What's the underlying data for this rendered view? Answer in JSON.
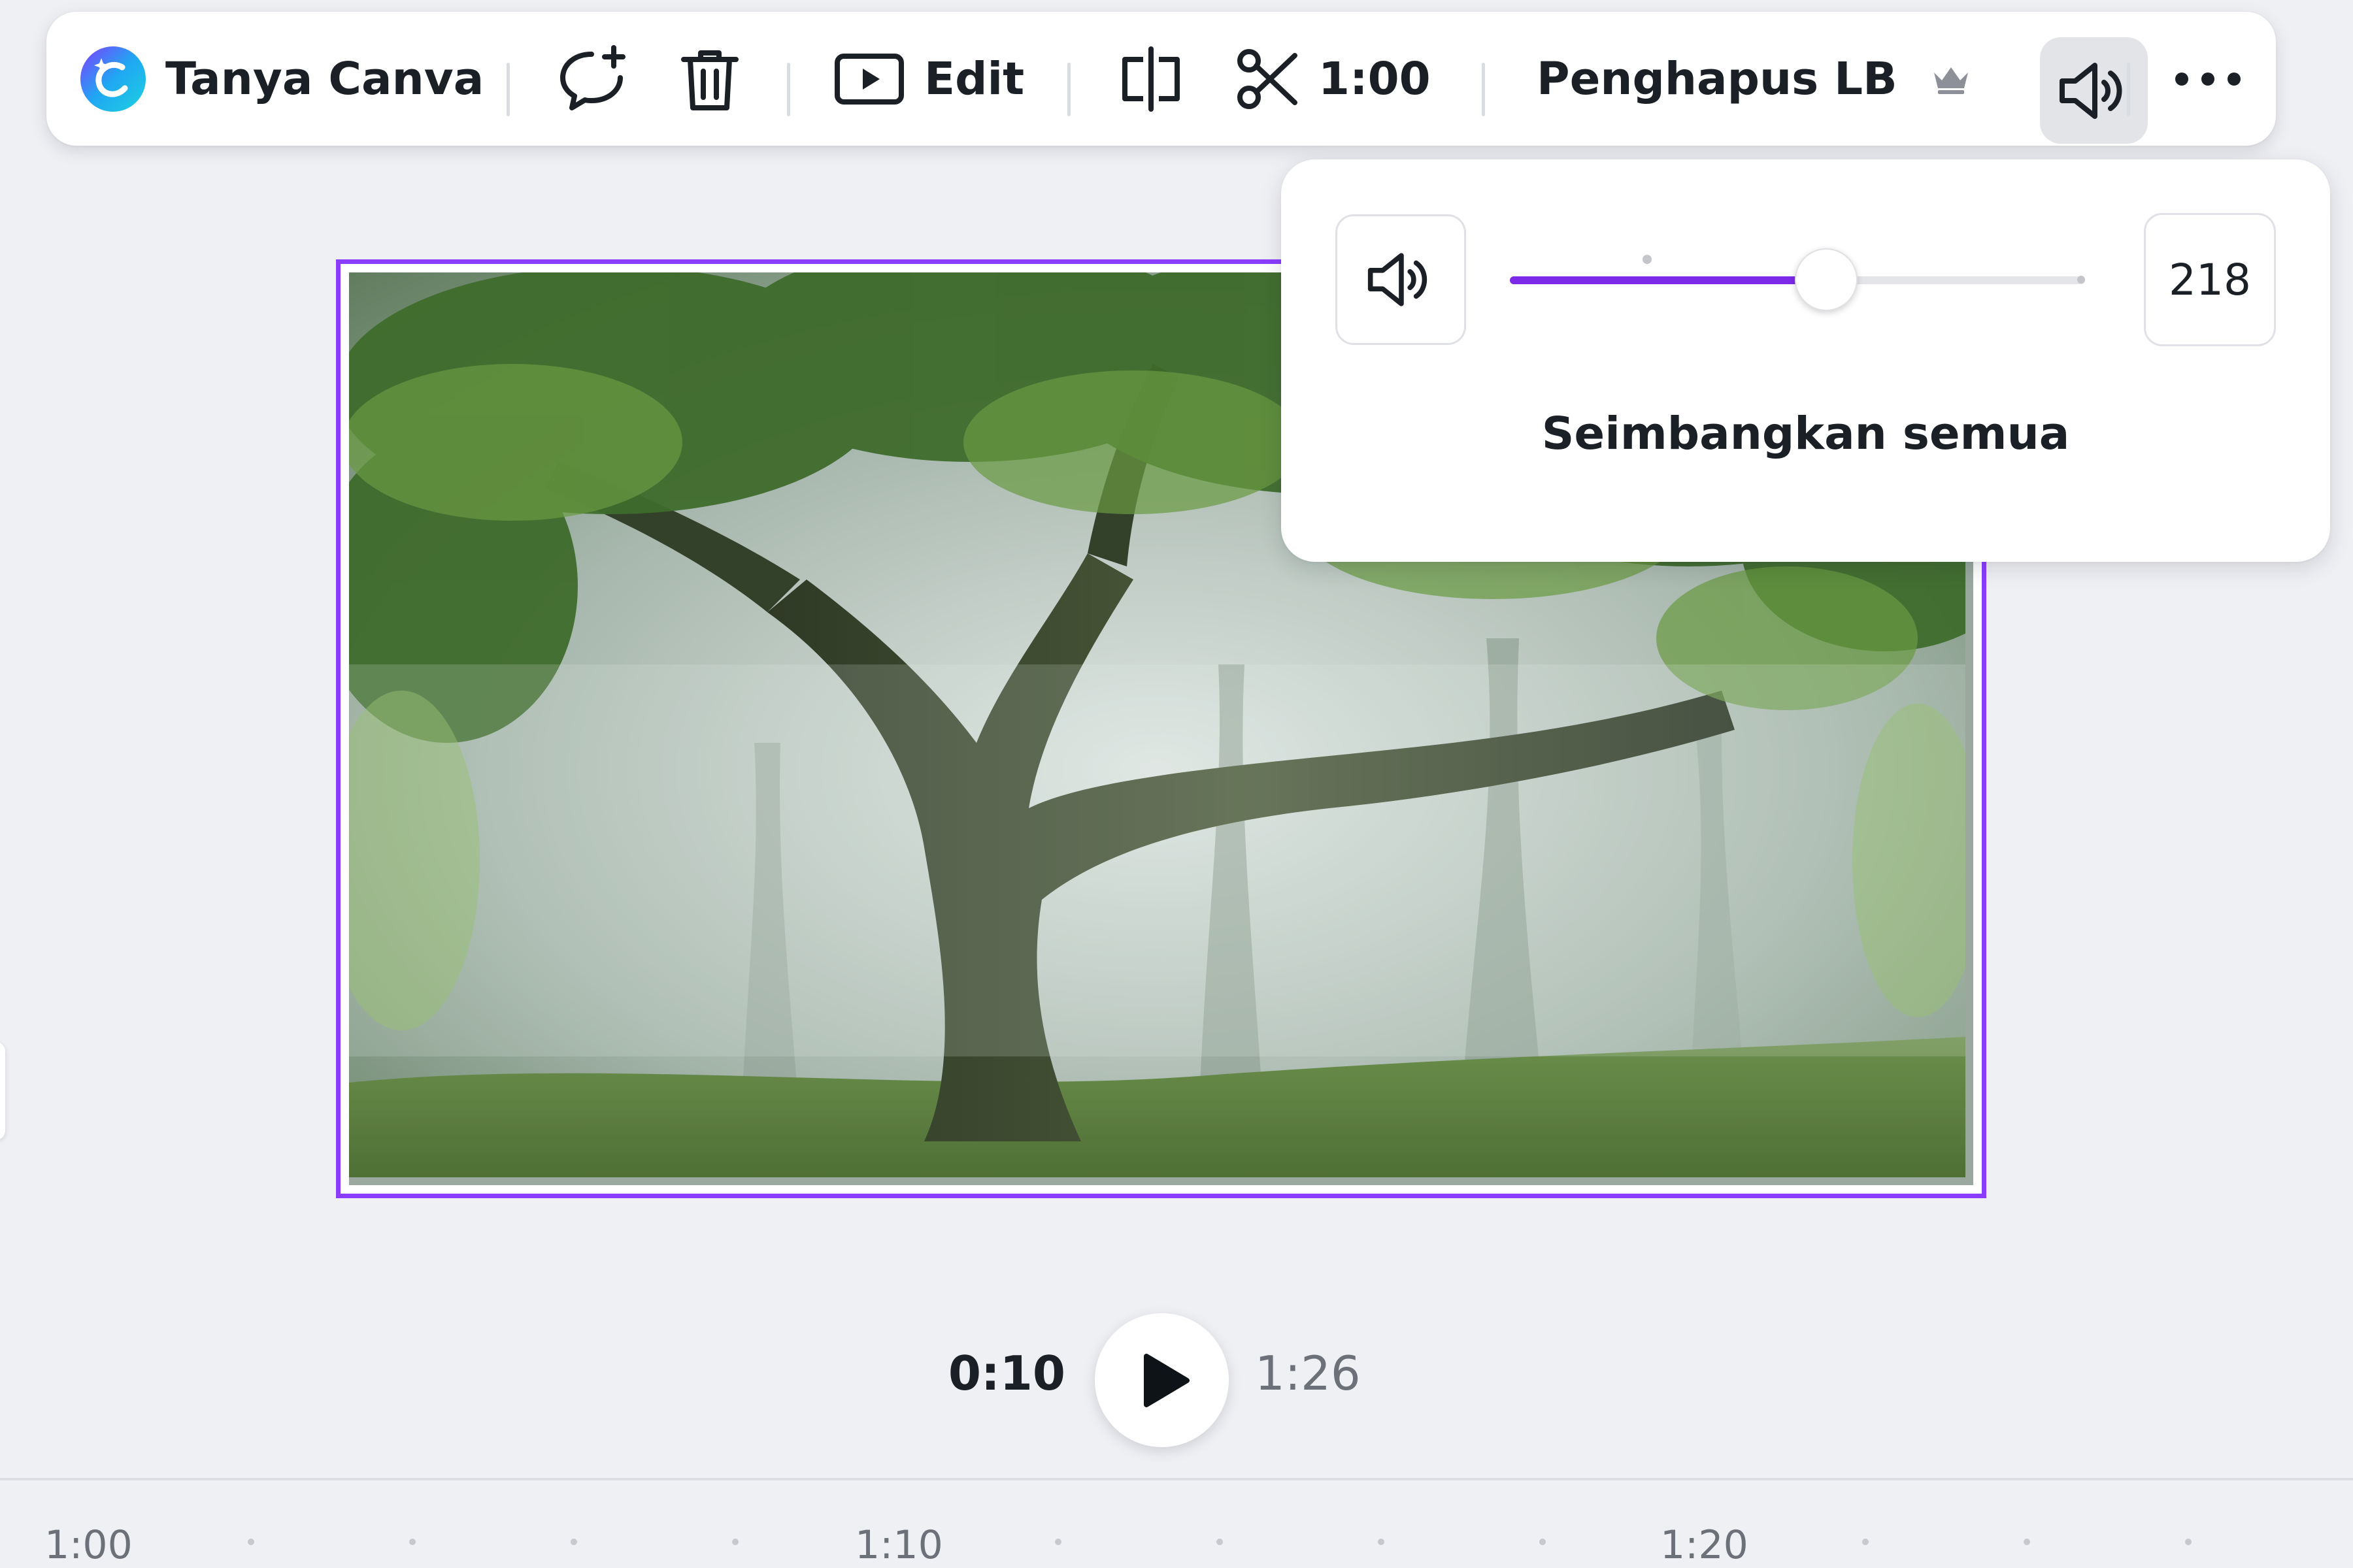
{
  "toolbar": {
    "magic_label": "Tanya Canva",
    "edit_label": "Edit",
    "duration_label": "1:00",
    "bg_remover_label": "Penghapus LB",
    "icons": {
      "magic": "canva-ai-logo-icon",
      "comment": "add-comment-icon",
      "delete": "trash-icon",
      "edit": "play-video-icon",
      "split": "split-icon",
      "trim": "scissors-icon",
      "pro": "crown-icon",
      "volume": "volume-icon",
      "more": "more-horizontal-icon"
    }
  },
  "volume_popup": {
    "value": "218",
    "slider_fraction": 0.55,
    "balance_label": "Seimbangkan semua"
  },
  "playback": {
    "current_time": "0:10",
    "total_time": "1:26"
  },
  "timeline": {
    "labels": [
      "1:00",
      "1:10",
      "1:20"
    ]
  },
  "colors": {
    "accent": "#8b3dff",
    "slider_fill": "#7d2ae8",
    "background": "#eff0f4"
  }
}
